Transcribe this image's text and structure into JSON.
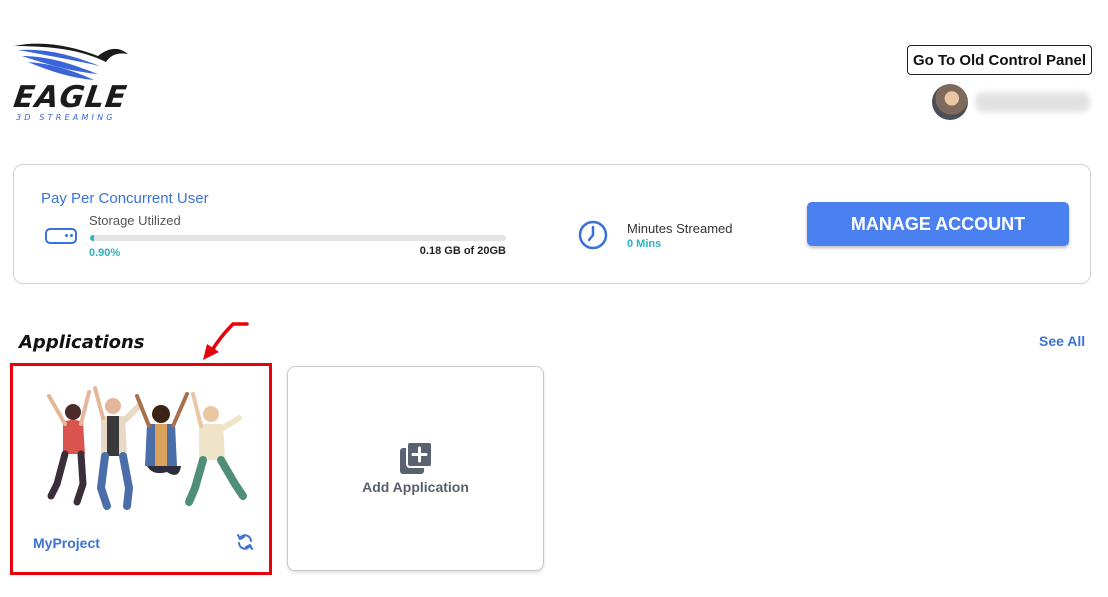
{
  "header": {
    "logo": {
      "word": "EAGLE",
      "subtitle": "3D STREAMING"
    },
    "old_panel_label": "Go To Old Control Panel"
  },
  "account": {
    "plan_title": "Pay Per Concurrent User",
    "storage_label": "Storage Utilized",
    "storage_percent_text": "0.90%",
    "storage_fraction": 0.009,
    "storage_size_text": "0.18 GB of 20GB",
    "minutes_label": "Minutes Streamed",
    "minutes_value": "0 Mins",
    "manage_label": "MANAGE ACCOUNT"
  },
  "applications": {
    "title": "Applications",
    "see_all_label": "See All",
    "items": [
      {
        "name": "MyProject"
      }
    ],
    "add_label": "Add Application"
  },
  "colors": {
    "accent": "#3b72d6",
    "button": "#4a80ef",
    "teal": "#2bb3c0",
    "highlight": "#e8000b"
  },
  "icons": {
    "storage": "storage-drive-icon",
    "clock": "clock-icon",
    "refresh": "refresh-icon",
    "add": "add-stack-icon"
  }
}
